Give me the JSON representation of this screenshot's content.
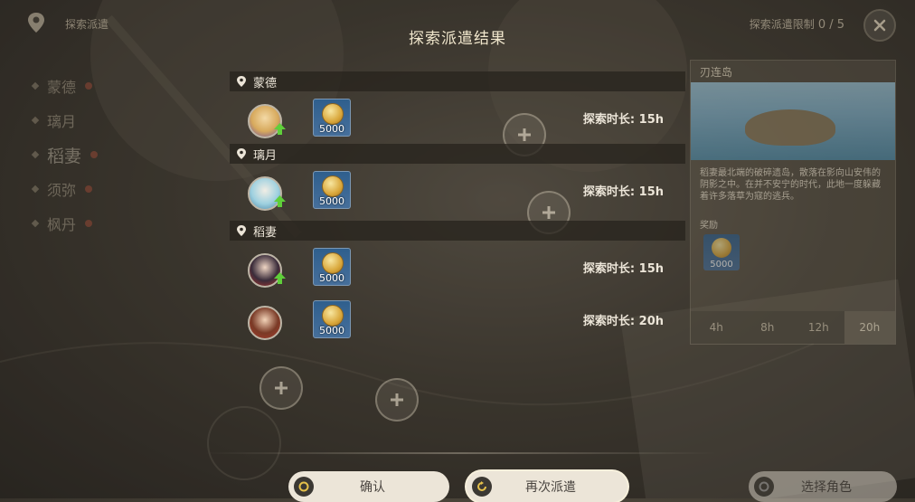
{
  "header": {
    "left_label": "探索派遣",
    "title": "探索派遣结果",
    "limit_label": "探索派遣限制",
    "limit_value": "0 / 5"
  },
  "sidebar": {
    "items": [
      {
        "label": "蒙德"
      },
      {
        "label": "璃月"
      },
      {
        "label": "稻妻"
      },
      {
        "label": "须弥"
      },
      {
        "label": "枫丹"
      }
    ]
  },
  "results": {
    "regions": [
      {
        "name": "蒙德",
        "rows": [
          {
            "reward_amount": "5000",
            "duration": "探索时长: 15h",
            "levelup": true
          }
        ]
      },
      {
        "name": "璃月",
        "rows": [
          {
            "reward_amount": "5000",
            "duration": "探索时长: 15h",
            "levelup": true
          }
        ]
      },
      {
        "name": "稻妻",
        "rows": [
          {
            "reward_amount": "5000",
            "duration": "探索时长: 15h",
            "levelup": true
          },
          {
            "reward_amount": "5000",
            "duration": "探索时长: 20h",
            "levelup": false
          }
        ]
      }
    ]
  },
  "info_panel": {
    "title": "刃连岛",
    "description": "稻妻最北端的破碎遗岛，散落在影向山安伟的阴影之中。在并不安宁的时代，此地一度躲藏着许多落草为寇的逃兵。",
    "reward_label": "奖励",
    "reward_amount": "5000",
    "time_tabs": [
      "4h",
      "8h",
      "12h",
      "20h"
    ],
    "selected_tab": "20h"
  },
  "buttons": {
    "confirm": "确认",
    "dispatch_again": "再次派遣",
    "select_character": "选择角色"
  },
  "colors": {
    "accent_text": "#ece5d8",
    "button_bg": "#ece5d8",
    "reward_bg": "#2f5f8d",
    "levelup_arrow": "#5fcf3a"
  }
}
